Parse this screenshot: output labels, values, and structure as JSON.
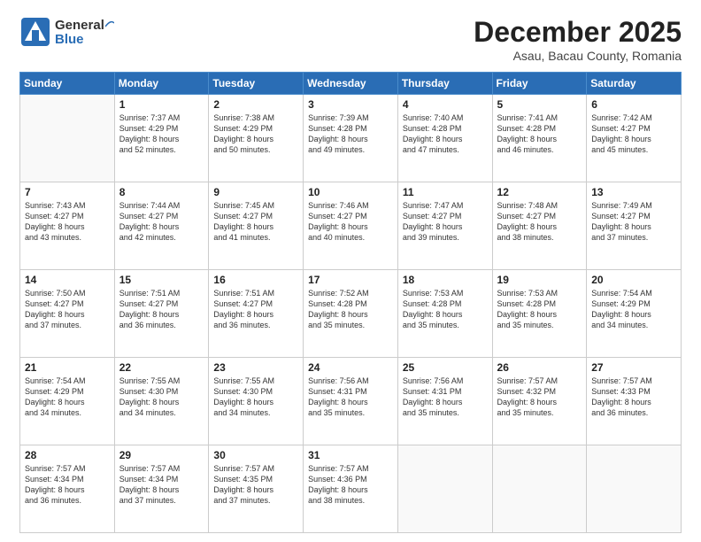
{
  "header": {
    "logo_general": "General",
    "logo_blue": "Blue",
    "month_title": "December 2025",
    "location": "Asau, Bacau County, Romania"
  },
  "days_of_week": [
    "Sunday",
    "Monday",
    "Tuesday",
    "Wednesday",
    "Thursday",
    "Friday",
    "Saturday"
  ],
  "weeks": [
    [
      {
        "day": "",
        "info": ""
      },
      {
        "day": "1",
        "info": "Sunrise: 7:37 AM\nSunset: 4:29 PM\nDaylight: 8 hours\nand 52 minutes."
      },
      {
        "day": "2",
        "info": "Sunrise: 7:38 AM\nSunset: 4:29 PM\nDaylight: 8 hours\nand 50 minutes."
      },
      {
        "day": "3",
        "info": "Sunrise: 7:39 AM\nSunset: 4:28 PM\nDaylight: 8 hours\nand 49 minutes."
      },
      {
        "day": "4",
        "info": "Sunrise: 7:40 AM\nSunset: 4:28 PM\nDaylight: 8 hours\nand 47 minutes."
      },
      {
        "day": "5",
        "info": "Sunrise: 7:41 AM\nSunset: 4:28 PM\nDaylight: 8 hours\nand 46 minutes."
      },
      {
        "day": "6",
        "info": "Sunrise: 7:42 AM\nSunset: 4:27 PM\nDaylight: 8 hours\nand 45 minutes."
      }
    ],
    [
      {
        "day": "7",
        "info": "Sunrise: 7:43 AM\nSunset: 4:27 PM\nDaylight: 8 hours\nand 43 minutes."
      },
      {
        "day": "8",
        "info": "Sunrise: 7:44 AM\nSunset: 4:27 PM\nDaylight: 8 hours\nand 42 minutes."
      },
      {
        "day": "9",
        "info": "Sunrise: 7:45 AM\nSunset: 4:27 PM\nDaylight: 8 hours\nand 41 minutes."
      },
      {
        "day": "10",
        "info": "Sunrise: 7:46 AM\nSunset: 4:27 PM\nDaylight: 8 hours\nand 40 minutes."
      },
      {
        "day": "11",
        "info": "Sunrise: 7:47 AM\nSunset: 4:27 PM\nDaylight: 8 hours\nand 39 minutes."
      },
      {
        "day": "12",
        "info": "Sunrise: 7:48 AM\nSunset: 4:27 PM\nDaylight: 8 hours\nand 38 minutes."
      },
      {
        "day": "13",
        "info": "Sunrise: 7:49 AM\nSunset: 4:27 PM\nDaylight: 8 hours\nand 37 minutes."
      }
    ],
    [
      {
        "day": "14",
        "info": "Sunrise: 7:50 AM\nSunset: 4:27 PM\nDaylight: 8 hours\nand 37 minutes."
      },
      {
        "day": "15",
        "info": "Sunrise: 7:51 AM\nSunset: 4:27 PM\nDaylight: 8 hours\nand 36 minutes."
      },
      {
        "day": "16",
        "info": "Sunrise: 7:51 AM\nSunset: 4:27 PM\nDaylight: 8 hours\nand 36 minutes."
      },
      {
        "day": "17",
        "info": "Sunrise: 7:52 AM\nSunset: 4:28 PM\nDaylight: 8 hours\nand 35 minutes."
      },
      {
        "day": "18",
        "info": "Sunrise: 7:53 AM\nSunset: 4:28 PM\nDaylight: 8 hours\nand 35 minutes."
      },
      {
        "day": "19",
        "info": "Sunrise: 7:53 AM\nSunset: 4:28 PM\nDaylight: 8 hours\nand 35 minutes."
      },
      {
        "day": "20",
        "info": "Sunrise: 7:54 AM\nSunset: 4:29 PM\nDaylight: 8 hours\nand 34 minutes."
      }
    ],
    [
      {
        "day": "21",
        "info": "Sunrise: 7:54 AM\nSunset: 4:29 PM\nDaylight: 8 hours\nand 34 minutes."
      },
      {
        "day": "22",
        "info": "Sunrise: 7:55 AM\nSunset: 4:30 PM\nDaylight: 8 hours\nand 34 minutes."
      },
      {
        "day": "23",
        "info": "Sunrise: 7:55 AM\nSunset: 4:30 PM\nDaylight: 8 hours\nand 34 minutes."
      },
      {
        "day": "24",
        "info": "Sunrise: 7:56 AM\nSunset: 4:31 PM\nDaylight: 8 hours\nand 35 minutes."
      },
      {
        "day": "25",
        "info": "Sunrise: 7:56 AM\nSunset: 4:31 PM\nDaylight: 8 hours\nand 35 minutes."
      },
      {
        "day": "26",
        "info": "Sunrise: 7:57 AM\nSunset: 4:32 PM\nDaylight: 8 hours\nand 35 minutes."
      },
      {
        "day": "27",
        "info": "Sunrise: 7:57 AM\nSunset: 4:33 PM\nDaylight: 8 hours\nand 36 minutes."
      }
    ],
    [
      {
        "day": "28",
        "info": "Sunrise: 7:57 AM\nSunset: 4:34 PM\nDaylight: 8 hours\nand 36 minutes."
      },
      {
        "day": "29",
        "info": "Sunrise: 7:57 AM\nSunset: 4:34 PM\nDaylight: 8 hours\nand 37 minutes."
      },
      {
        "day": "30",
        "info": "Sunrise: 7:57 AM\nSunset: 4:35 PM\nDaylight: 8 hours\nand 37 minutes."
      },
      {
        "day": "31",
        "info": "Sunrise: 7:57 AM\nSunset: 4:36 PM\nDaylight: 8 hours\nand 38 minutes."
      },
      {
        "day": "",
        "info": ""
      },
      {
        "day": "",
        "info": ""
      },
      {
        "day": "",
        "info": ""
      }
    ]
  ]
}
